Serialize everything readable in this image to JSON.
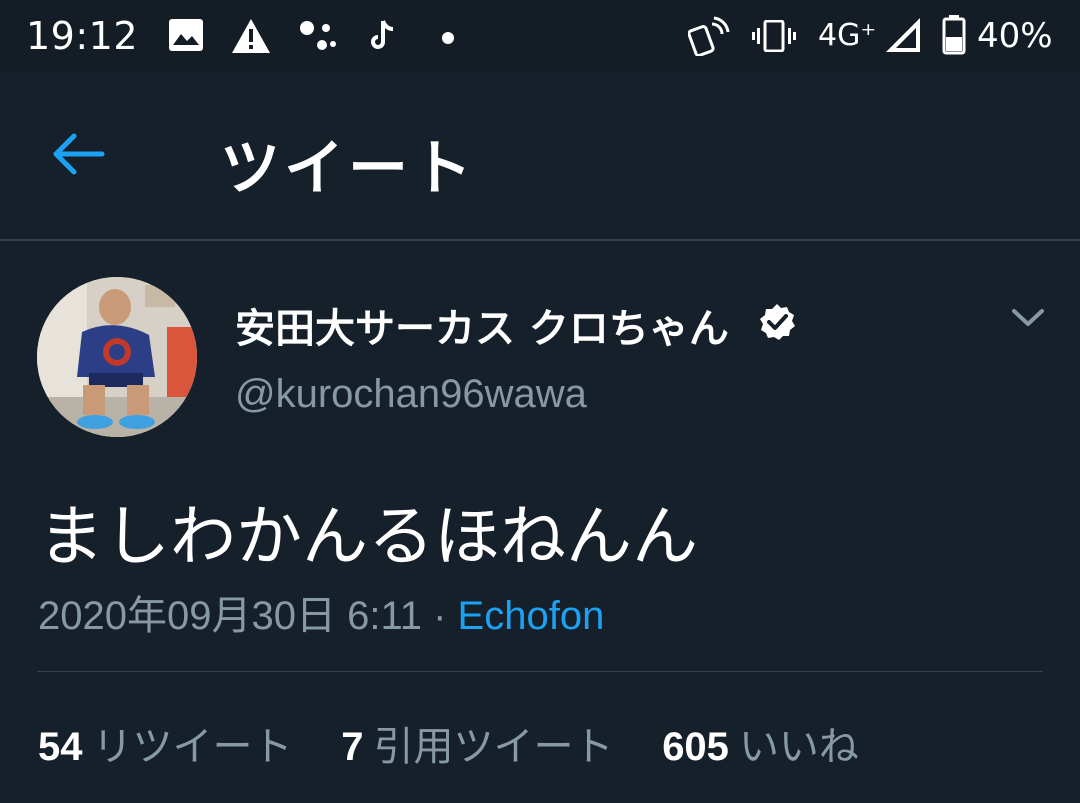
{
  "status_bar": {
    "time": "19:12",
    "left_icons": [
      "image-icon",
      "warning-icon",
      "assistant-dots-icon",
      "tiktok-icon",
      "dot-icon"
    ],
    "right_icons": [
      "nfc-phone-icon",
      "vibrate-icon",
      "signal-icon",
      "battery-icon"
    ],
    "network": "4G⁺",
    "battery": "40%"
  },
  "header": {
    "title": "ツイート",
    "back_icon": "arrow-left-icon"
  },
  "tweet": {
    "display_name": "安田大サーカス クロちゃん",
    "handle": "@kurochan96wawa",
    "text": "ましわかんるほねんん",
    "timestamp": "2020年09月30日 6:11",
    "separator": "·",
    "source": "Echofon",
    "stats": [
      {
        "count": "54",
        "label": "リツイート"
      },
      {
        "count": "7",
        "label": "引用ツイート"
      },
      {
        "count": "605",
        "label": "いいね"
      }
    ]
  },
  "colors": {
    "background": "#15202b",
    "status_bar": "#141d26",
    "accent": "#1da1f2",
    "secondary_text": "#8899a6",
    "divider": "#38444d"
  }
}
